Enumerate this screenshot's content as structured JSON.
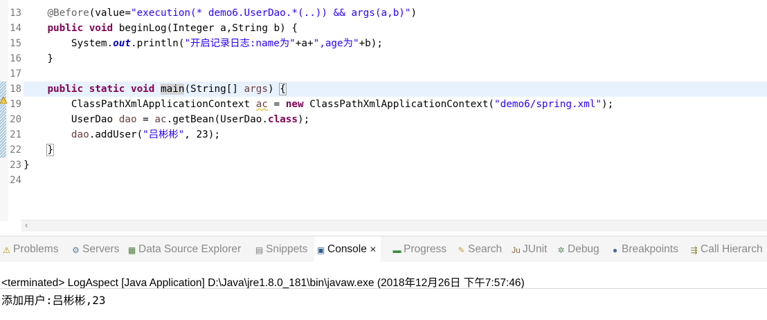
{
  "editor": {
    "line_numbers": [
      "13",
      "14",
      "15",
      "16",
      "17",
      "18",
      "19",
      "20",
      "21",
      "22",
      "23",
      "24"
    ],
    "line13": {
      "indent": "    ",
      "annotation": "@Before",
      "open": "(value=",
      "pointcut": "\"execution(* demo6.UserDao.*(..)) && args(a,b)\"",
      "close": ")"
    },
    "line14": {
      "indent": "    ",
      "kw_public": "public",
      "kw_void": "void",
      "rest": " beginLog(Integer a,String b) {"
    },
    "line15": {
      "indent": "        ",
      "system": "System.",
      "out": "out",
      "call": ".println(",
      "str1": "\"开启记录日志:name为\"",
      "mid": "+a+",
      "str2": "\",age为\"",
      "end": "+b);"
    },
    "line16": "    }",
    "line18": {
      "indent": "    ",
      "kw_public": "public",
      "kw_static": "static",
      "kw_void": "void",
      "main": "main",
      "params_open": "(String[] ",
      "args": "args",
      "params_close": ") ",
      "brace": "{"
    },
    "line19": {
      "indent": "        ",
      "type": "ClassPathXmlApplicationContext ",
      "var": "ac",
      "eq": " = ",
      "kw_new": "new",
      "ctor": " ClassPathXmlApplicationContext(",
      "str": "\"demo6/spring.xml\"",
      "end": ");"
    },
    "line20": {
      "indent": "        ",
      "type": "UserDao ",
      "var": "dao",
      "eq": " = ",
      "ac": "ac",
      "call": ".getBean(UserDao.",
      "kw_class": "class",
      "end": ");"
    },
    "line21": {
      "indent": "        ",
      "dao": "dao",
      "call": ".addUser(",
      "str": "\"吕彬彬\"",
      "end": ", 23);"
    },
    "line22": {
      "indent": "    ",
      "brace": "}"
    },
    "line23": "}"
  },
  "tabs": [
    {
      "label": "Problems",
      "icon": "problems-icon",
      "glyph": "⚠",
      "color": "#b58c00"
    },
    {
      "label": "Servers",
      "icon": "servers-icon",
      "glyph": "⚙",
      "color": "#5b7d9a"
    },
    {
      "label": "Data Source Explorer",
      "icon": "data-source-icon",
      "glyph": "▦",
      "color": "#4a7a3a"
    },
    {
      "label": "Snippets",
      "icon": "snippets-icon",
      "glyph": "▤",
      "color": "#7a7a7a"
    },
    {
      "label": "Console",
      "icon": "console-icon",
      "glyph": "▣",
      "color": "#2f5f8f"
    },
    {
      "label": "Progress",
      "icon": "progress-icon",
      "glyph": "▬",
      "color": "#3a8a3a"
    },
    {
      "label": "Search",
      "icon": "search-icon",
      "glyph": "✎",
      "color": "#c8a040"
    },
    {
      "label": "JUnit",
      "icon": "junit-icon",
      "glyph": "Ju",
      "color": "#8a6a3a"
    },
    {
      "label": "Debug",
      "icon": "debug-icon",
      "glyph": "✲",
      "color": "#5a8a5a"
    },
    {
      "label": "Breakpoints",
      "icon": "breakpoints-icon",
      "glyph": "●",
      "color": "#4a6a9a"
    },
    {
      "label": "Call Hierarch",
      "icon": "call-hierarchy-icon",
      "glyph": "⇶",
      "color": "#8a8a3a"
    }
  ],
  "console": {
    "close_glyph": "✕",
    "terminated": "<terminated> LogAspect [Java Application] D:\\Java\\jre1.8.0_181\\bin\\javaw.exe (2018年12月26日 下午7:57:46)",
    "output": "添加用户:吕彬彬,23"
  },
  "colors": {
    "keyword": "#7f0055",
    "string": "#2a00ff",
    "annotation": "#646464",
    "static_field": "#0000c0",
    "local_variable": "#6a3e3e",
    "current_line": "#e8f2fe"
  }
}
